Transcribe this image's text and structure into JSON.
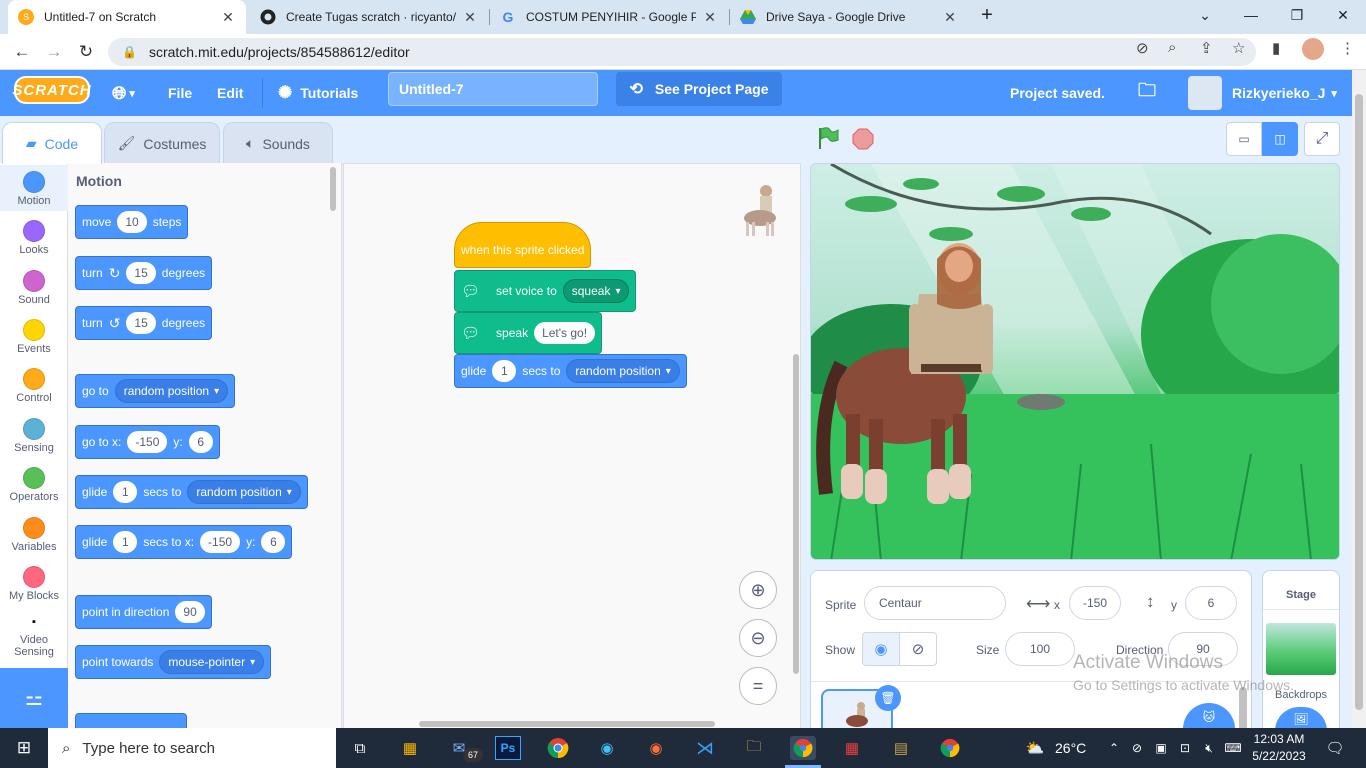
{
  "browser": {
    "tabs": [
      {
        "title": "Untitled-7 on Scratch",
        "active": true,
        "icon": "scratch-favicon"
      },
      {
        "title": "Create Tugas scratch · ricyanto/R",
        "active": false,
        "icon": "github-favicon"
      },
      {
        "title": "COSTUM PENYIHIR - Google Pen",
        "active": false,
        "icon": "google-favicon"
      },
      {
        "title": "Drive Saya - Google Drive",
        "active": false,
        "icon": "drive-favicon"
      }
    ],
    "url": "scratch.mit.edu/projects/854588612/editor"
  },
  "menubar": {
    "logo": "SCRATCH",
    "file": "File",
    "edit": "Edit",
    "tutorials": "Tutorials",
    "project_title": "Untitled-7",
    "see_project_page": "See Project Page",
    "status": "Project saved.",
    "username": "Rizkyerieko_J"
  },
  "editor_tabs": {
    "code": "Code",
    "costumes": "Costumes",
    "sounds": "Sounds"
  },
  "categories": [
    {
      "label": "Motion",
      "color": "#4c97ff"
    },
    {
      "label": "Looks",
      "color": "#9966ff"
    },
    {
      "label": "Sound",
      "color": "#cf63cf"
    },
    {
      "label": "Events",
      "color": "#ffd500"
    },
    {
      "label": "Control",
      "color": "#ffab19"
    },
    {
      "label": "Sensing",
      "color": "#5cb1d6"
    },
    {
      "label": "Operators",
      "color": "#59c059"
    },
    {
      "label": "Variables",
      "color": "#ff8c1a"
    },
    {
      "label": "My Blocks",
      "color": "#ff6680"
    },
    {
      "label": "Video Sensing",
      "color": "#0fbd8c"
    }
  ],
  "palette": {
    "heading": "Motion",
    "move": {
      "a": "move",
      "v": "10",
      "b": "steps"
    },
    "turn_right": {
      "a": "turn",
      "v": "15",
      "b": "degrees"
    },
    "turn_left": {
      "a": "turn",
      "v": "15",
      "b": "degrees"
    },
    "goto": {
      "a": "go to",
      "d": "random position"
    },
    "gotoxy": {
      "a": "go to x:",
      "x": "-150",
      "yl": "y:",
      "y": "6"
    },
    "glide": {
      "a": "glide",
      "v": "1",
      "b": "secs to",
      "d": "random position"
    },
    "glidexy": {
      "a": "glide",
      "v": "1",
      "b": "secs to x:",
      "x": "-150",
      "yl": "y:",
      "y": "6"
    },
    "point_dir": {
      "a": "point in direction",
      "v": "90"
    },
    "point_towards": {
      "a": "point towards",
      "d": "mouse-pointer"
    }
  },
  "script": {
    "hat": "when this sprite clicked",
    "set_voice": {
      "a": "set voice to",
      "d": "squeak"
    },
    "speak": {
      "a": "speak",
      "v": "Let's go!"
    },
    "glide": {
      "a": "glide",
      "v": "1",
      "b": "secs to",
      "d": "random position"
    }
  },
  "sprite_info": {
    "sprite_label": "Sprite",
    "sprite_name": "Centaur",
    "x_label": "x",
    "x": "-150",
    "y_label": "y",
    "y": "6",
    "show_label": "Show",
    "size_label": "Size",
    "size": "100",
    "direction_label": "Direction",
    "direction": "90"
  },
  "stage_panel": {
    "title": "Stage",
    "backdrops": "Backdrops"
  },
  "watermark": {
    "line1": "Activate Windows",
    "line2": "Go to Settings to activate Windows."
  },
  "taskbar": {
    "search_placeholder": "Type here to search",
    "weather": "26°C",
    "time": "12:03 AM",
    "date": "5/22/2023",
    "mail_badge": "67"
  }
}
